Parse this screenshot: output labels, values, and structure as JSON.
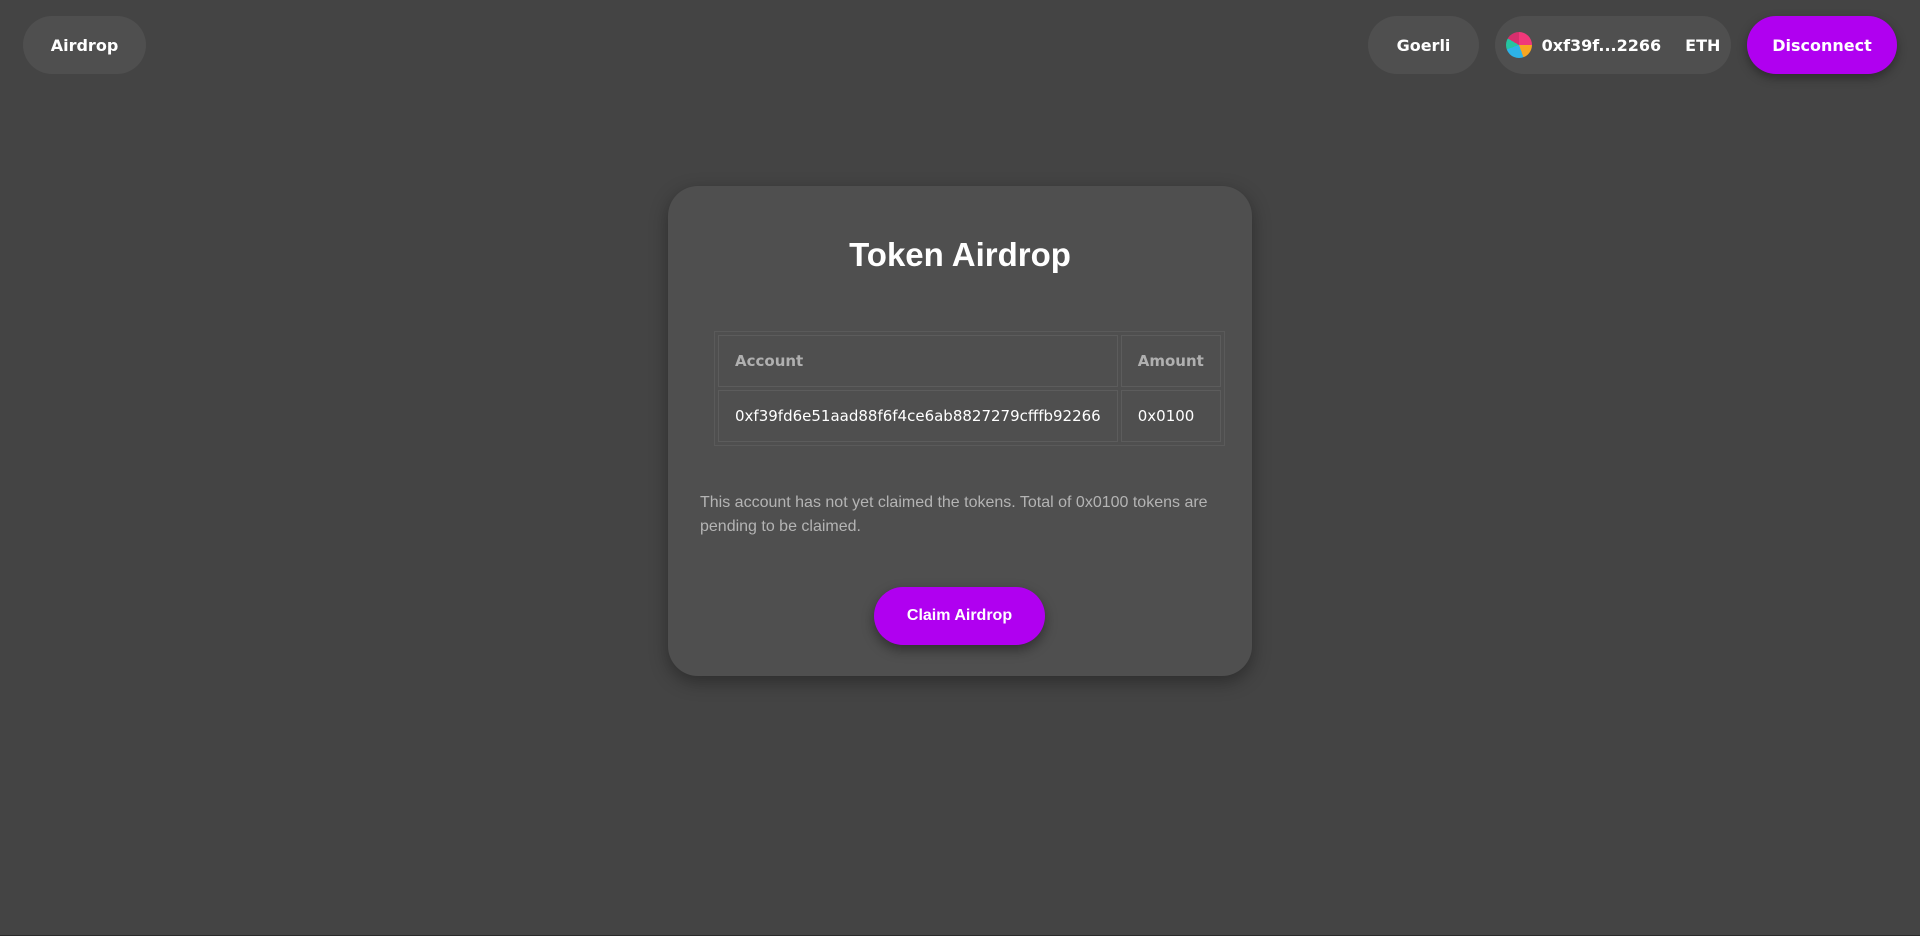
{
  "header": {
    "app_button_label": "Airdrop",
    "network_label": "Goerli",
    "account_short": "0xf39f...2266",
    "currency": "ETH",
    "disconnect_label": "Disconnect"
  },
  "card": {
    "title": "Token Airdrop",
    "table": {
      "columns": [
        "Account",
        "Amount"
      ],
      "rows": [
        {
          "account": "0xf39fd6e51aad88f6f4ce6ab8827279cfffb92266",
          "amount": "0x0100"
        }
      ]
    },
    "status_text": "This account has not yet claimed the tokens. Total of 0x0100 tokens are pending to be claimed.",
    "claim_button_label": "Claim Airdrop"
  },
  "icons": {
    "avatar": "wallet-avatar-icon"
  },
  "colors": {
    "background": "#444444",
    "card": "#4f4f4f",
    "pill": "#4f4f4f",
    "accent": "#b000f0",
    "muted_text": "#b4b4b4"
  }
}
